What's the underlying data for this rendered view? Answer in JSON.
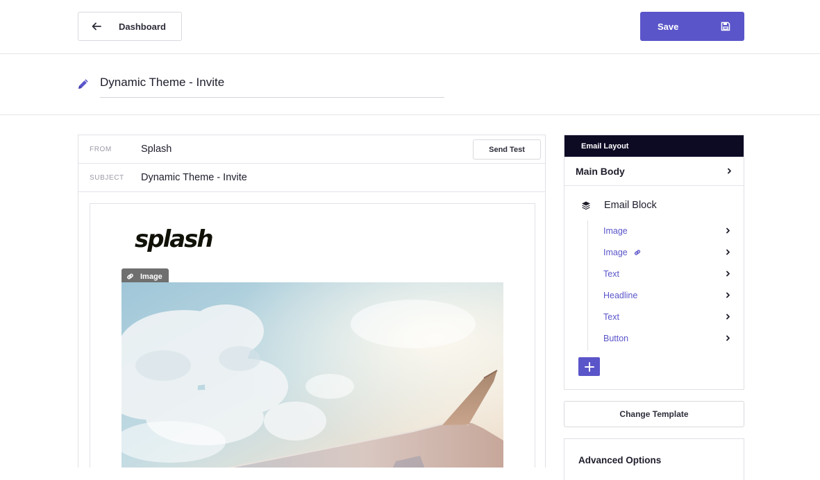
{
  "header": {
    "back_label": "Dashboard",
    "save_label": "Save"
  },
  "title": {
    "value": "Dynamic Theme - Invite"
  },
  "editor": {
    "from_label": "FROM",
    "from_value": "Splash",
    "send_test_label": "Send Test",
    "subject_label": "SUBJECT",
    "subject_value": "Dynamic Theme - Invite",
    "logo_text": "splash",
    "image_tag_label": "Image"
  },
  "layout": {
    "header": "Email Layout",
    "main_body": "Main Body",
    "block_title": "Email Block",
    "items": [
      {
        "label": "Image",
        "linked": false
      },
      {
        "label": "Image",
        "linked": true
      },
      {
        "label": "Text",
        "linked": false
      },
      {
        "label": "Headline",
        "linked": false
      },
      {
        "label": "Text",
        "linked": false
      },
      {
        "label": "Button",
        "linked": false
      }
    ]
  },
  "change_template_label": "Change Template",
  "advanced_title": "Advanced Options",
  "colors": {
    "accent": "#5a55c9",
    "panel_header": "#0d0a24"
  }
}
